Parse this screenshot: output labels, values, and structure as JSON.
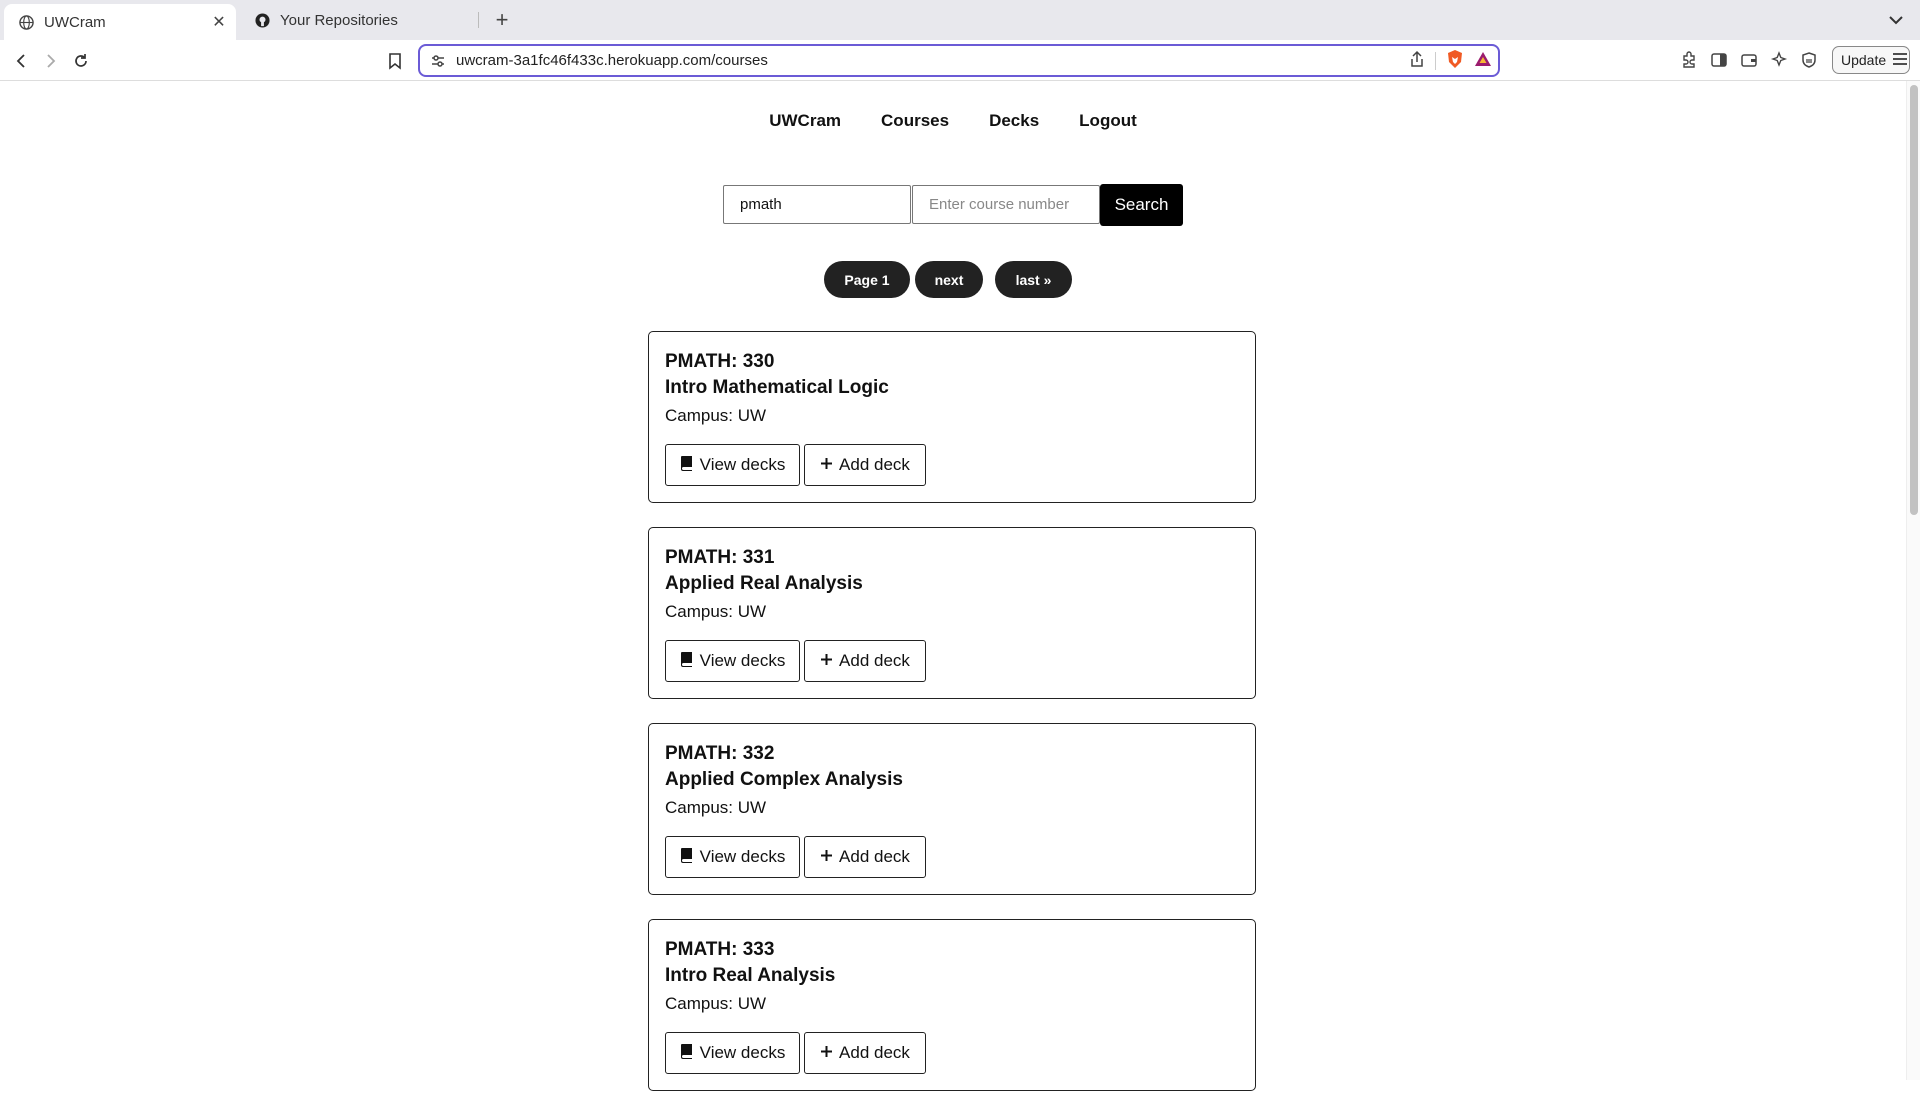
{
  "browser": {
    "tabs": [
      {
        "title": "UWCram",
        "active": true
      },
      {
        "title": "Your Repositories",
        "active": false
      }
    ],
    "url": "uwcram-3a1fc46f433c.herokuapp.com/courses",
    "update_label": "Update"
  },
  "nav": {
    "brand": "UWCram",
    "courses": "Courses",
    "decks": "Decks",
    "logout": "Logout"
  },
  "search": {
    "subject_value": "pmath",
    "number_placeholder": "Enter course number",
    "button": "Search"
  },
  "pagination": {
    "current": "Page 1",
    "next": "next",
    "last": "last »"
  },
  "courses": [
    {
      "code": "PMATH: 330",
      "name": "Intro Mathematical Logic",
      "campus": "Campus: UW"
    },
    {
      "code": "PMATH: 331",
      "name": "Applied Real Analysis",
      "campus": "Campus: UW"
    },
    {
      "code": "PMATH: 332",
      "name": "Applied Complex Analysis",
      "campus": "Campus: UW"
    },
    {
      "code": "PMATH: 333",
      "name": "Intro Real Analysis",
      "campus": "Campus: UW"
    }
  ],
  "card_actions": {
    "view": "View decks",
    "add": "Add deck"
  }
}
